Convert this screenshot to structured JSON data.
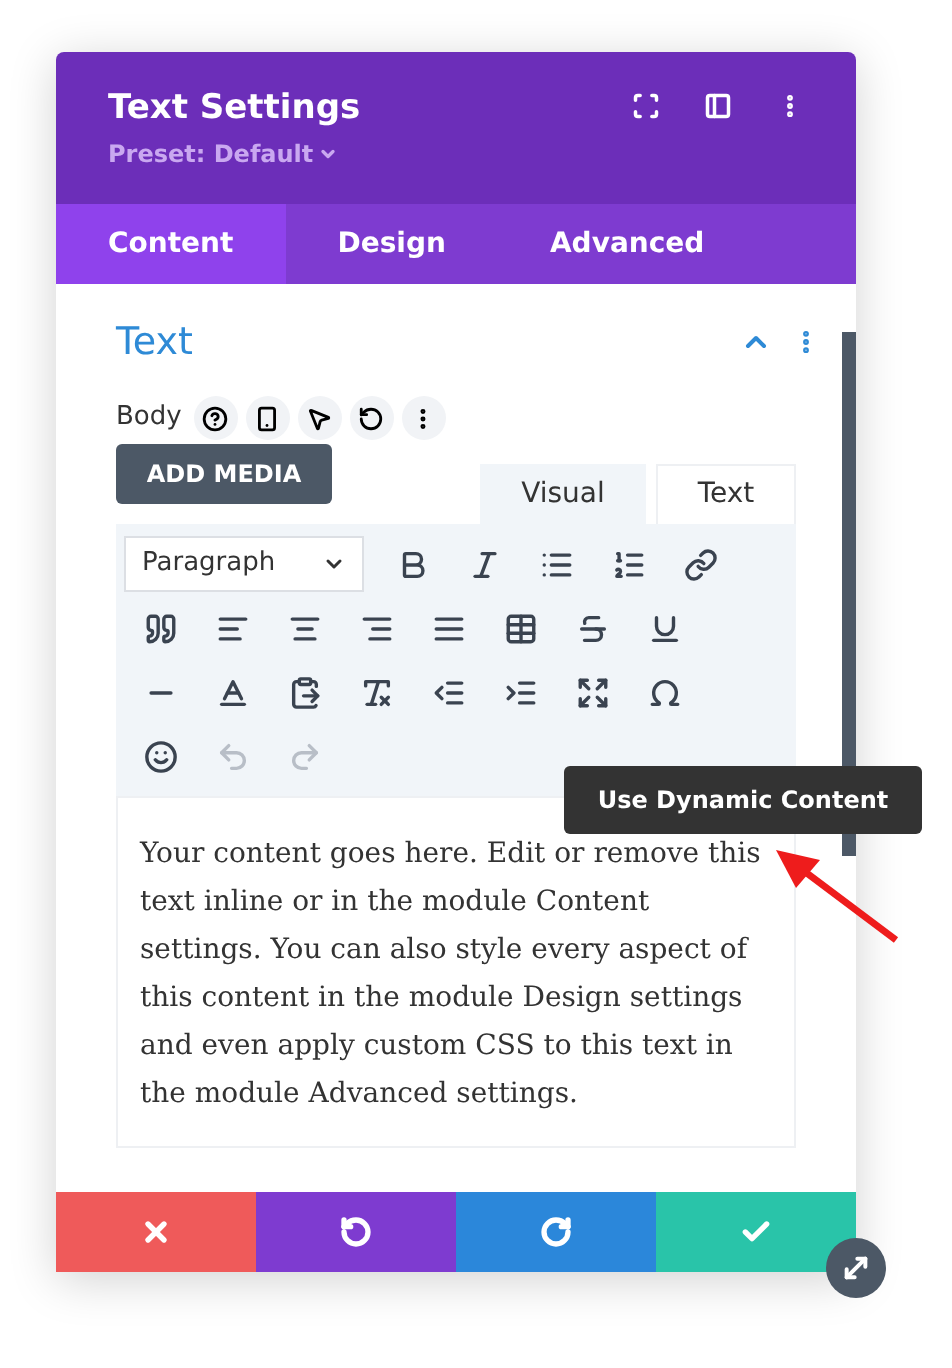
{
  "header": {
    "title": "Text Settings",
    "preset": "Preset: Default"
  },
  "tabs": [
    {
      "label": "Content",
      "selected": true
    },
    {
      "label": "Design",
      "selected": false
    },
    {
      "label": "Advanced",
      "selected": false
    }
  ],
  "section": {
    "title": "Text",
    "expanded": true,
    "field_label": "Body",
    "add_media": "ADD MEDIA",
    "editor_tabs": [
      {
        "label": "Visual",
        "selected": true
      },
      {
        "label": "Text",
        "selected": false
      }
    ],
    "format_select": "Paragraph",
    "toolbar": [
      [
        {
          "kind": "bold",
          "disabled": false
        },
        {
          "kind": "italic",
          "disabled": false
        },
        {
          "kind": "bullets",
          "disabled": false
        },
        {
          "kind": "numbers",
          "disabled": false
        },
        {
          "kind": "link",
          "disabled": false
        }
      ],
      [
        {
          "kind": "quote",
          "disabled": false
        },
        {
          "kind": "align-left",
          "disabled": false
        },
        {
          "kind": "align-center",
          "disabled": false
        },
        {
          "kind": "align-right",
          "disabled": false
        },
        {
          "kind": "justify",
          "disabled": false
        },
        {
          "kind": "table",
          "disabled": false
        },
        {
          "kind": "strike",
          "disabled": false
        },
        {
          "kind": "underline",
          "disabled": false
        }
      ],
      [
        {
          "kind": "rule",
          "disabled": false
        },
        {
          "kind": "color",
          "disabled": false
        },
        {
          "kind": "paste",
          "disabled": false
        },
        {
          "kind": "clear",
          "disabled": false
        },
        {
          "kind": "outdent",
          "disabled": false
        },
        {
          "kind": "indent",
          "disabled": false
        },
        {
          "kind": "fullscreen",
          "disabled": false
        },
        {
          "kind": "symbol",
          "disabled": false
        }
      ],
      [
        {
          "kind": "emoji",
          "disabled": false
        },
        {
          "kind": "undo",
          "disabled": true
        },
        {
          "kind": "redo",
          "disabled": true
        }
      ]
    ],
    "content": "Your content goes here. Edit or remove this text inline or in the module Content settings. You can also style every aspect of this content in the module Design settings and even apply custom CSS to this text in the module Advanced settings."
  },
  "tooltip": "Use Dynamic Content"
}
